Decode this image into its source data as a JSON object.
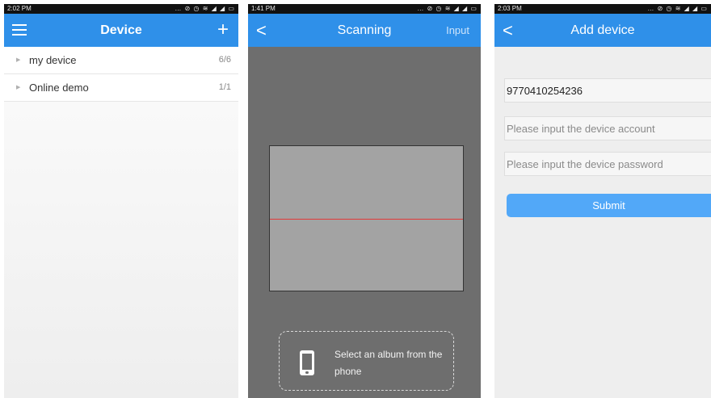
{
  "screen1": {
    "status_time": "2:02 PM",
    "status_icons": "… ⊘ ◷ ≋ ◢ ◢ ▭",
    "title": "Device",
    "add_symbol": "+",
    "groups": [
      {
        "name": "my device",
        "count": "6/6"
      },
      {
        "name": "Online demo",
        "count": "1/1"
      }
    ],
    "accent": "#2f90e9"
  },
  "screen2": {
    "status_time": "1:41 PM",
    "status_icons": "… ⊘ ◷ ≋ ◢ ◢ ▭",
    "back_symbol": "<",
    "title": "Scanning",
    "input_label": "Input",
    "album_text": "Select an album from the phone",
    "scan_line_color": "#e23a3a"
  },
  "screen3": {
    "status_time": "2:03 PM",
    "status_icons": "… ⊘ ◷ ≋ ◢ ◢ ▭",
    "back_symbol": "<",
    "title": "Add device",
    "device_id_value": "9770410254236",
    "account_placeholder": "Please input the device account",
    "password_placeholder": "Please input the device password",
    "submit_label": "Submit",
    "button_color": "#52a8f8"
  }
}
